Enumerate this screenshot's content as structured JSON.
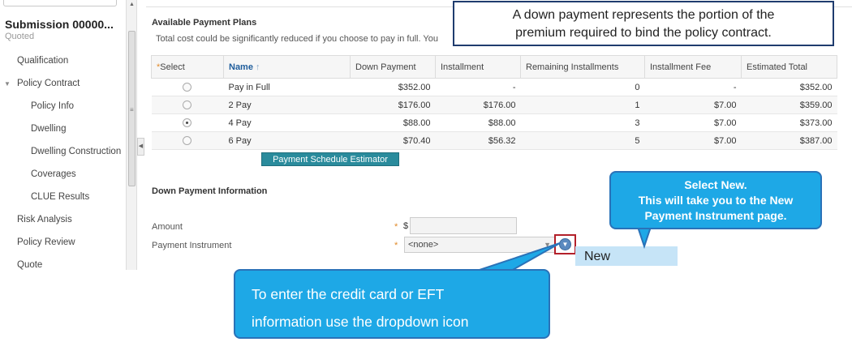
{
  "sidebar": {
    "submission_title": "Submission 00000...",
    "status": "Quoted",
    "items": [
      {
        "label": "Qualification"
      },
      {
        "label": "Policy Contract"
      },
      {
        "label": "Policy Info"
      },
      {
        "label": "Dwelling"
      },
      {
        "label": "Dwelling Construction"
      },
      {
        "label": "Coverages"
      },
      {
        "label": "CLUE Results"
      },
      {
        "label": "Risk Analysis"
      },
      {
        "label": "Policy Review"
      },
      {
        "label": "Quote"
      }
    ]
  },
  "plans": {
    "title": "Available Payment Plans",
    "description": "Total cost could be significantly reduced if you choose to pay in full. You",
    "columns": [
      "Select",
      "Name",
      "Down Payment",
      "Installment",
      "Remaining Installments",
      "Installment Fee",
      "Estimated Total"
    ],
    "sort_indicator": "↑",
    "rows": [
      {
        "selected": false,
        "name": "Pay in Full",
        "down": "$352.00",
        "installment": "-",
        "remaining": "0",
        "fee": "-",
        "total": "$352.00"
      },
      {
        "selected": false,
        "name": "2 Pay",
        "down": "$176.00",
        "installment": "$176.00",
        "remaining": "1",
        "fee": "$7.00",
        "total": "$359.00"
      },
      {
        "selected": true,
        "name": "4 Pay",
        "down": "$88.00",
        "installment": "$88.00",
        "remaining": "3",
        "fee": "$7.00",
        "total": "$373.00"
      },
      {
        "selected": false,
        "name": "6 Pay",
        "down": "$70.40",
        "installment": "$56.32",
        "remaining": "5",
        "fee": "$7.00",
        "total": "$387.00"
      }
    ],
    "estimator_button": "Payment Schedule Estimator"
  },
  "down_payment": {
    "title": "Down Payment Information",
    "amount_label": "Amount",
    "currency": "$",
    "amount_value": "",
    "instrument_label": "Payment Instrument",
    "instrument_value": "<none>",
    "required_mark": "*",
    "new_option": "New"
  },
  "callouts": {
    "down_payment": [
      "A down payment represents the portion of the",
      "premium required to bind the policy contract."
    ],
    "select_new": [
      "Select New.",
      "This will take you  to the New",
      "Payment Instrument page."
    ],
    "dropdown": [
      "To enter the credit card or EFT",
      "information use the dropdown icon"
    ]
  },
  "colors": {
    "accent_button": "#2a8b9c",
    "callout_blue": "#1ea8e6",
    "highlight_red": "#b3202a",
    "new_option_bg": "#c6e4f7"
  }
}
